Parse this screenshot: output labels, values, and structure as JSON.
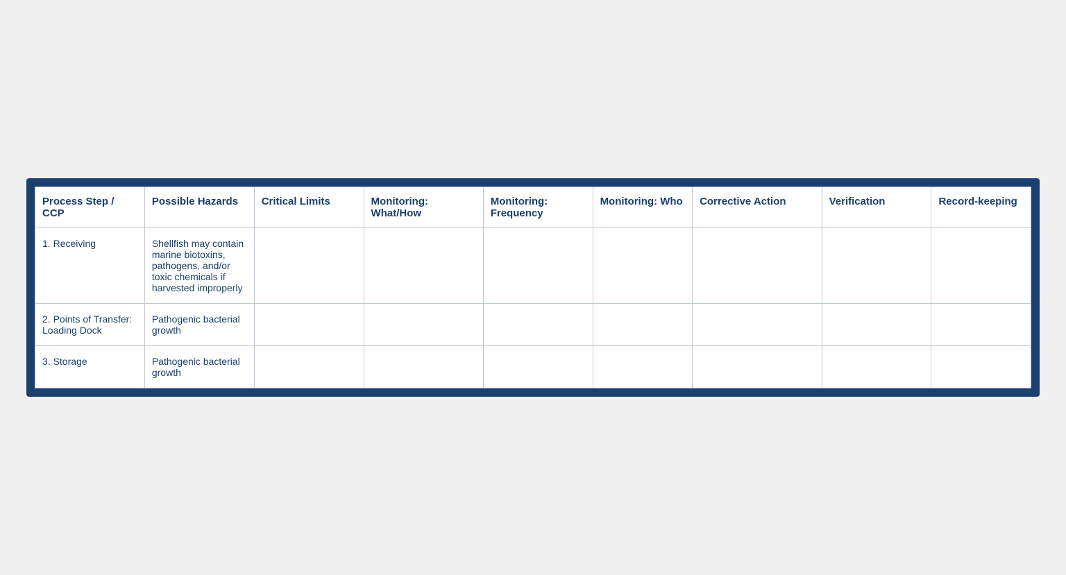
{
  "table": {
    "columns": [
      {
        "id": "process_step",
        "label": "Process Step / CCP"
      },
      {
        "id": "possible_hazards",
        "label": "Possible Hazards"
      },
      {
        "id": "critical_limits",
        "label": "Critical Limits"
      },
      {
        "id": "monitoring_what",
        "label": "Monitoring: What/How"
      },
      {
        "id": "monitoring_freq",
        "label": "Monitoring: Frequency"
      },
      {
        "id": "monitoring_who",
        "label": "Monitoring: Who"
      },
      {
        "id": "corrective_action",
        "label": "Corrective Action"
      },
      {
        "id": "verification",
        "label": "Verification"
      },
      {
        "id": "recordkeeping",
        "label": "Record-keeping"
      }
    ],
    "rows": [
      {
        "process_step": "1.    Receiving",
        "possible_hazards": "Shellfish may contain marine biotoxins, pathogens, and/or toxic chemicals if harvested improperly",
        "critical_limits": "",
        "monitoring_what": "",
        "monitoring_freq": "",
        "monitoring_who": "",
        "corrective_action": "",
        "verification": "",
        "recordkeeping": ""
      },
      {
        "process_step": "2.    Points of Transfer: Loading Dock",
        "possible_hazards": "Pathogenic bacterial growth",
        "critical_limits": "",
        "monitoring_what": "",
        "monitoring_freq": "",
        "monitoring_who": "",
        "corrective_action": "",
        "verification": "",
        "recordkeeping": ""
      },
      {
        "process_step": "3.    Storage",
        "possible_hazards": "Pathogenic bacterial growth",
        "critical_limits": "",
        "monitoring_what": "",
        "monitoring_freq": "",
        "monitoring_who": "",
        "corrective_action": "",
        "verification": "",
        "recordkeeping": ""
      }
    ]
  }
}
